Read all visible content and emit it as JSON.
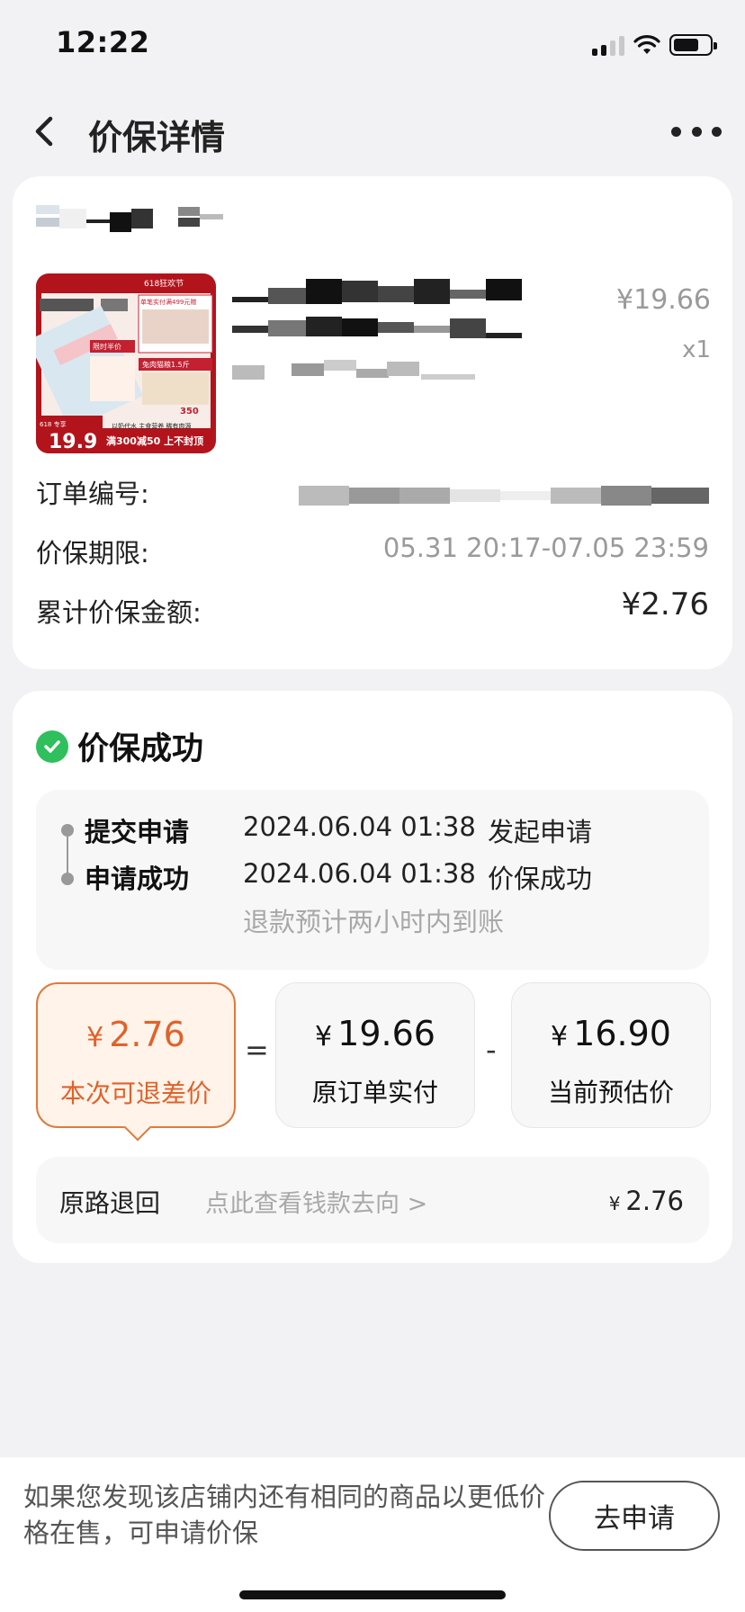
{
  "status_bar": {
    "time": "12:22"
  },
  "nav": {
    "title": "价保详情",
    "back_icon": "chevron-left-icon",
    "more_icon": "more-dots-icon"
  },
  "order": {
    "price": "¥19.66",
    "quantity": "x1",
    "order_no_label": "订单编号:",
    "period_label": "价保期限:",
    "period_value": "05.31 20:17-07.05 23:59",
    "total_label": "累计价保金额:",
    "total_value": "¥2.76",
    "product_image_text": {
      "banner": "618狂欢节",
      "promo1": "单笔实付满499元赠",
      "promo2": "限时半价",
      "promo3": "兔肉猫粮1.5斤",
      "price_tag": "19.9",
      "footer": "满300减50 上不封顶",
      "side_text": "以奶代水 主食营养 稀有肉源",
      "price_badge": "350"
    }
  },
  "result": {
    "status": "价保成功",
    "timeline": [
      {
        "step": "提交申请",
        "time": "2024.06.04 01:38",
        "desc": "发起申请"
      },
      {
        "step": "申请成功",
        "time": "2024.06.04 01:38",
        "desc": "价保成功"
      }
    ],
    "note": "退款预计两小时内到账",
    "currency": "¥",
    "refund_amount": "2.76",
    "refund_label": "本次可退差价",
    "paid_amount": "19.66",
    "paid_label": "原订单实付",
    "est_amount": "16.90",
    "est_label": "当前预估价",
    "op_equal": "=",
    "op_minus": "-",
    "route_label": "原路退回",
    "route_link": "点此查看钱款去向 >",
    "route_amount": "2.76"
  },
  "bottom": {
    "tip": "如果您发现该店铺内还有相同的商品以更低价格在售，可申请价保",
    "apply_button": "去申请"
  },
  "colors": {
    "accent": "#e0622a",
    "success": "#2fbf5c",
    "background": "#f2f2f4"
  }
}
